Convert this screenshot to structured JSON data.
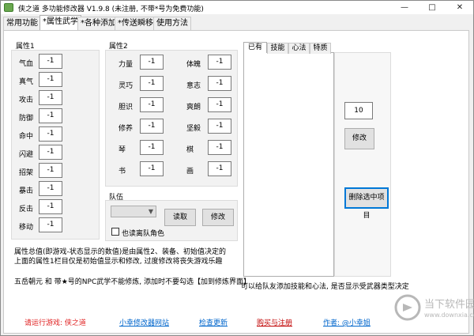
{
  "window": {
    "title": "侠之道 多功能修改器 V1.9.8 (未注册, 不带*号为免费功能)",
    "controls": [
      "—",
      "□",
      "✕"
    ]
  },
  "tabs": [
    {
      "label": "常用功能",
      "active": false
    },
    {
      "label": "*属性武学",
      "active": true
    },
    {
      "label": "*各种添加",
      "active": false
    },
    {
      "label": "*传送瞬移",
      "active": false
    },
    {
      "label": "使用方法",
      "active": false
    }
  ],
  "attr1": {
    "title": "属性1",
    "rows": [
      {
        "label": "气血",
        "value": "-1"
      },
      {
        "label": "真气",
        "value": "-1"
      },
      {
        "label": "攻击",
        "value": "-1"
      },
      {
        "label": "防御",
        "value": "-1"
      },
      {
        "label": "命中",
        "value": "-1"
      },
      {
        "label": "闪避",
        "value": "-1"
      },
      {
        "label": "招架",
        "value": "-1"
      },
      {
        "label": "暴击",
        "value": "-1"
      },
      {
        "label": "反击",
        "value": "-1"
      },
      {
        "label": "移动",
        "value": "-1"
      }
    ]
  },
  "attr2": {
    "title": "属性2",
    "left": [
      {
        "label": "力量",
        "value": "-1"
      },
      {
        "label": "灵巧",
        "value": "-1"
      },
      {
        "label": "胆识",
        "value": "-1"
      },
      {
        "label": "修养",
        "value": "-1"
      },
      {
        "label": "琴",
        "value": "-1"
      },
      {
        "label": "书",
        "value": "-1"
      }
    ],
    "right": [
      {
        "label": "体魄",
        "value": "-1"
      },
      {
        "label": "意志",
        "value": "-1"
      },
      {
        "label": "爽朗",
        "value": "-1"
      },
      {
        "label": "坚毅",
        "value": "-1"
      },
      {
        "label": "棋",
        "value": "-1"
      },
      {
        "label": "画",
        "value": "-1"
      }
    ]
  },
  "team": {
    "title": "队伍",
    "select_value": "",
    "read_label": "读取",
    "modify_label": "修改",
    "checkbox_label": "也读离队角色",
    "checked": false
  },
  "skills": {
    "tabs": [
      {
        "label": "已有",
        "active": true
      },
      {
        "label": "技能",
        "active": false
      },
      {
        "label": "心法",
        "active": false
      },
      {
        "label": "特质",
        "active": false
      }
    ],
    "value": "10",
    "modify_label": "修改",
    "delete_label": "删除选中项目",
    "note": "可以给队友添加技能和心法, 是否显示受武器类型决定"
  },
  "notes": {
    "line1": "属性总值(即游戏-状态显示的数值)是由属性2、装备、初始值决定的",
    "line2": "上面的属性1栏目仅是初始值显示和修改, 过度修改将丧失游戏乐趣",
    "line3": "五岳朝元 和 带★号的NPC武学不能修炼, 添加时不要勾选【加到修炼界面】"
  },
  "footer": {
    "status": "请运行游戏: 侠之道",
    "site": "小幸修改器网站",
    "update": "检查更新",
    "buy": "购买与注册",
    "author": "作者: @小幸姐"
  },
  "watermark": {
    "title": "当下软件园",
    "url": "www.downxia.com"
  },
  "colors": {
    "status_red": "#e02020",
    "link_blue": "#0066cc",
    "buy_red": "#c00000",
    "focus_blue": "#0078d7",
    "watermark_gray": "#b8b8b8"
  }
}
